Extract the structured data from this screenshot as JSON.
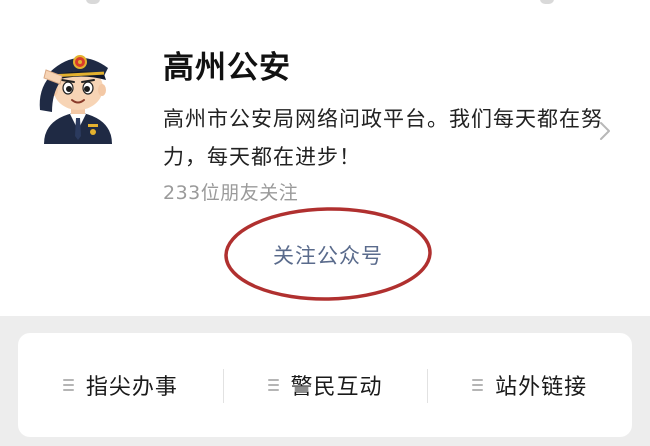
{
  "account": {
    "name": "高州公安",
    "description": "高州市公安局网络问政平台。我们每天都在努力，每天都在进步！",
    "followers": "233位朋友关注",
    "avatar_icon": "police-officer-saluting-icon"
  },
  "follow_button": {
    "label": "关注公众号",
    "highlight_color": "#b0302f"
  },
  "menu": {
    "items": [
      {
        "label": "指尖办事",
        "icon": "menu-lines-icon"
      },
      {
        "label": "警民互动",
        "icon": "menu-lines-icon"
      },
      {
        "label": "站外链接",
        "icon": "menu-lines-icon"
      }
    ]
  },
  "colors": {
    "link_text": "#5a6b8c",
    "secondary_text": "#9a9a9a",
    "background_band": "#ededed"
  }
}
